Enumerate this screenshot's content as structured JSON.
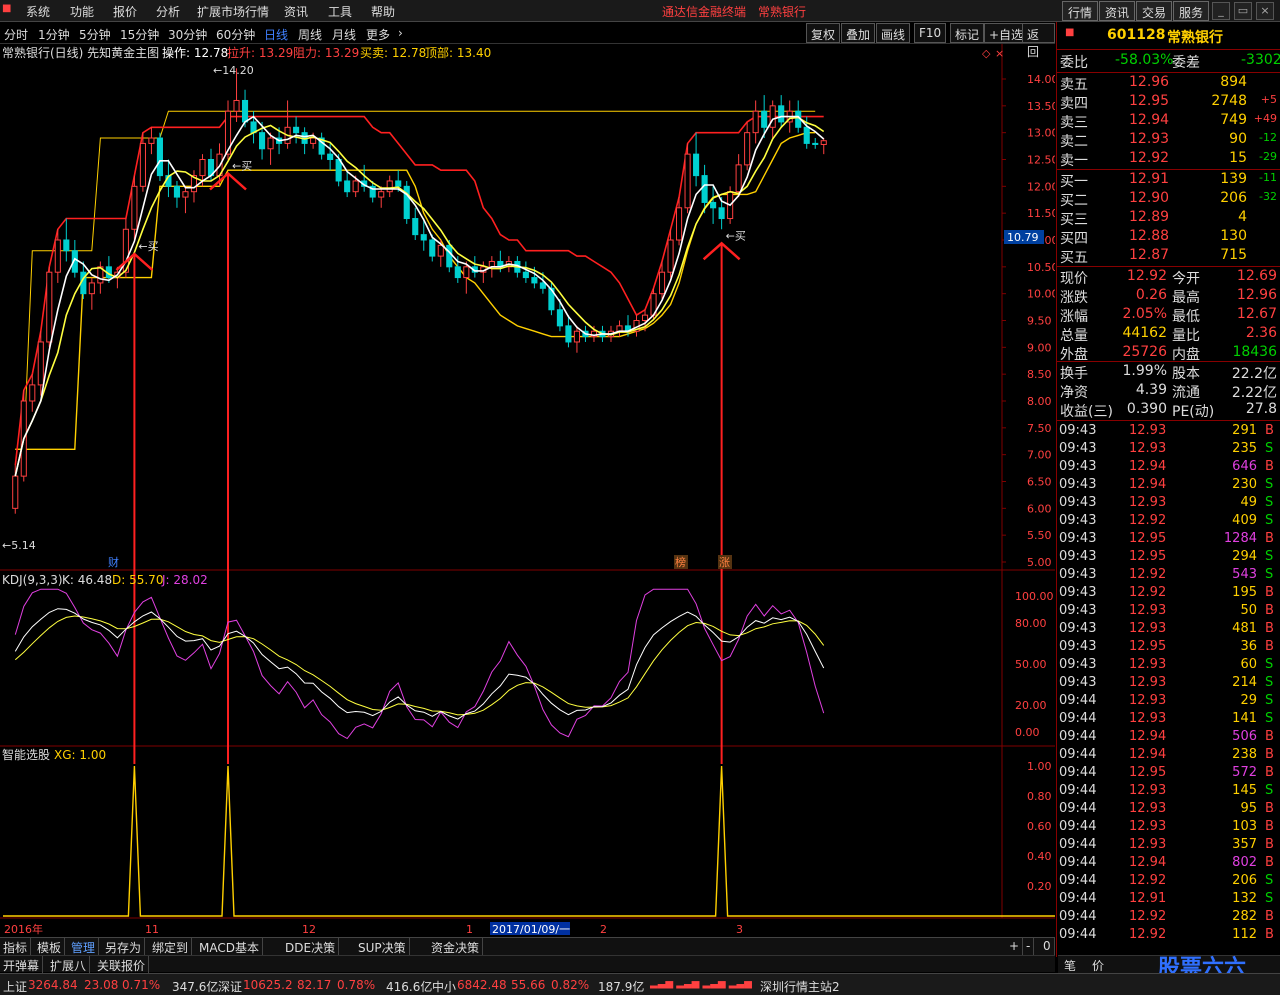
{
  "menu": {
    "items": [
      "系统",
      "功能",
      "报价",
      "分析",
      "扩展市场行情",
      "资讯",
      "工具",
      "帮助"
    ],
    "title": "通达信金融终端",
    "title_stock": "常熟银行",
    "right_buttons": [
      "行情",
      "资讯",
      "交易",
      "服务"
    ]
  },
  "periods": {
    "items": [
      "分时",
      "1分钟",
      "5分钟",
      "15分钟",
      "30分钟",
      "60分钟",
      "日线",
      "周线",
      "月线",
      "更多"
    ],
    "active": "日线",
    "tools": [
      "复权",
      "叠加",
      "画线",
      "F10",
      "标记",
      "+自选",
      "返回"
    ]
  },
  "main_header": {
    "name": "常熟银行(日线) 先知黄金主图",
    "op_label": "操作: 12.78",
    "la_label": "拉升: 13.29",
    "zl_label": "阻力: 13.29",
    "mm_label": "买卖: 12.78",
    "db_label": "顶部: 13.40"
  },
  "chart_data": {
    "type": "candlestick",
    "price_axis": [
      "14.00",
      "13.50",
      "13.00",
      "12.50",
      "12.00",
      "11.50",
      "11.00",
      "10.50",
      "10.00",
      "9.50",
      "9.00",
      "8.50",
      "8.00",
      "7.50",
      "7.00",
      "6.50",
      "6.00",
      "5.50",
      "5.00"
    ],
    "price_range": [
      5.0,
      14.0
    ],
    "current_price_label": "10.79",
    "annotations": {
      "high": "14.20",
      "low": "5.14",
      "buy": "买",
      "cai": "财",
      "bang": "榜",
      "zhang": "涨"
    },
    "candles": [
      [
        6.0,
        6.8,
        5.9,
        6.6
      ],
      [
        6.6,
        8.2,
        6.5,
        8.0
      ],
      [
        8.0,
        8.5,
        7.8,
        8.3
      ],
      [
        8.3,
        9.3,
        8.1,
        9.1
      ],
      [
        9.1,
        10.5,
        9.0,
        10.4
      ],
      [
        10.4,
        11.2,
        10.2,
        11.0
      ],
      [
        11.0,
        11.4,
        10.6,
        10.8
      ],
      [
        10.8,
        11.0,
        10.3,
        10.4
      ],
      [
        10.4,
        10.6,
        9.9,
        10.0
      ],
      [
        10.0,
        10.3,
        9.7,
        10.2
      ],
      [
        10.2,
        10.6,
        10.0,
        10.5
      ],
      [
        10.5,
        10.7,
        10.2,
        10.3
      ],
      [
        10.3,
        10.5,
        10.1,
        10.4
      ],
      [
        10.4,
        11.4,
        10.3,
        11.2
      ],
      [
        11.2,
        12.2,
        11.0,
        12.0
      ],
      [
        12.0,
        13.0,
        11.9,
        12.8
      ],
      [
        12.8,
        13.1,
        12.6,
        12.9
      ],
      [
        12.9,
        13.0,
        12.1,
        12.2
      ],
      [
        12.2,
        12.5,
        11.8,
        12.0
      ],
      [
        12.0,
        12.1,
        11.6,
        11.8
      ],
      [
        11.8,
        12.0,
        11.5,
        11.9
      ],
      [
        11.9,
        12.3,
        11.7,
        12.2
      ],
      [
        12.2,
        12.6,
        12.0,
        12.5
      ],
      [
        12.5,
        12.7,
        12.1,
        12.2
      ],
      [
        12.2,
        12.8,
        12.0,
        12.6
      ],
      [
        12.6,
        13.6,
        12.5,
        13.4
      ],
      [
        13.4,
        14.2,
        13.2,
        13.6
      ],
      [
        13.6,
        13.8,
        13.1,
        13.2
      ],
      [
        13.2,
        13.4,
        12.8,
        13.0
      ],
      [
        13.0,
        13.2,
        12.5,
        12.7
      ],
      [
        12.7,
        13.0,
        12.4,
        12.9
      ],
      [
        12.9,
        13.1,
        12.6,
        12.8
      ],
      [
        12.8,
        13.6,
        12.7,
        13.1
      ],
      [
        13.1,
        13.3,
        12.8,
        13.0
      ],
      [
        13.0,
        13.1,
        12.6,
        12.8
      ],
      [
        12.8,
        13.0,
        12.7,
        12.9
      ],
      [
        12.9,
        13.0,
        12.5,
        12.6
      ],
      [
        12.6,
        12.8,
        12.3,
        12.5
      ],
      [
        12.5,
        12.6,
        12.0,
        12.1
      ],
      [
        12.1,
        12.3,
        11.8,
        11.9
      ],
      [
        11.9,
        12.2,
        11.8,
        12.1
      ],
      [
        12.1,
        12.4,
        11.9,
        12.0
      ],
      [
        12.0,
        12.1,
        11.7,
        11.8
      ],
      [
        11.8,
        12.0,
        11.6,
        11.9
      ],
      [
        11.9,
        12.2,
        11.8,
        12.1
      ],
      [
        12.1,
        12.3,
        11.9,
        12.0
      ],
      [
        12.0,
        12.1,
        11.3,
        11.4
      ],
      [
        11.4,
        11.6,
        11.0,
        11.1
      ],
      [
        11.1,
        11.4,
        10.8,
        11.0
      ],
      [
        11.0,
        11.1,
        10.6,
        10.7
      ],
      [
        10.7,
        11.0,
        10.5,
        10.9
      ],
      [
        10.9,
        11.0,
        10.4,
        10.5
      ],
      [
        10.5,
        10.7,
        10.2,
        10.3
      ],
      [
        10.3,
        10.6,
        10.0,
        10.5
      ],
      [
        10.5,
        10.7,
        10.3,
        10.4
      ],
      [
        10.4,
        10.6,
        10.2,
        10.5
      ],
      [
        10.5,
        10.7,
        10.3,
        10.6
      ],
      [
        10.6,
        10.8,
        10.4,
        10.5
      ],
      [
        10.5,
        10.7,
        10.4,
        10.6
      ],
      [
        10.6,
        10.7,
        10.3,
        10.4
      ],
      [
        10.4,
        10.6,
        10.2,
        10.3
      ],
      [
        10.3,
        10.5,
        10.1,
        10.2
      ],
      [
        10.2,
        10.4,
        10.0,
        10.1
      ],
      [
        10.1,
        10.2,
        9.6,
        9.7
      ],
      [
        9.7,
        9.9,
        9.3,
        9.4
      ],
      [
        9.4,
        9.6,
        9.0,
        9.1
      ],
      [
        9.1,
        9.4,
        8.9,
        9.3
      ],
      [
        9.3,
        9.4,
        9.1,
        9.2
      ],
      [
        9.2,
        9.4,
        9.1,
        9.3
      ],
      [
        9.3,
        9.4,
        9.1,
        9.2
      ],
      [
        9.2,
        9.4,
        9.1,
        9.3
      ],
      [
        9.3,
        9.5,
        9.2,
        9.4
      ],
      [
        9.4,
        9.6,
        9.2,
        9.3
      ],
      [
        9.3,
        9.6,
        9.2,
        9.5
      ],
      [
        9.5,
        9.7,
        9.3,
        9.6
      ],
      [
        9.6,
        10.1,
        9.5,
        10.0
      ],
      [
        10.0,
        10.6,
        9.9,
        10.4
      ],
      [
        10.4,
        11.2,
        10.3,
        11.0
      ],
      [
        11.0,
        11.8,
        10.9,
        11.6
      ],
      [
        11.6,
        12.8,
        11.5,
        12.6
      ],
      [
        12.6,
        13.0,
        12.0,
        12.2
      ],
      [
        12.2,
        12.4,
        11.5,
        11.7
      ],
      [
        11.7,
        12.0,
        11.3,
        11.6
      ],
      [
        11.6,
        11.8,
        11.2,
        11.4
      ],
      [
        11.4,
        12.0,
        11.3,
        11.9
      ],
      [
        11.9,
        12.6,
        11.8,
        12.4
      ],
      [
        12.4,
        13.2,
        12.3,
        13.0
      ],
      [
        13.0,
        13.6,
        12.8,
        13.4
      ],
      [
        13.4,
        13.7,
        12.9,
        13.1
      ],
      [
        13.1,
        13.6,
        12.9,
        13.5
      ],
      [
        13.5,
        13.7,
        13.1,
        13.2
      ],
      [
        13.2,
        13.6,
        13.0,
        13.4
      ],
      [
        13.4,
        13.6,
        13.0,
        13.1
      ],
      [
        13.1,
        13.3,
        12.7,
        12.8
      ],
      [
        12.8,
        12.9,
        12.7,
        12.78
      ],
      [
        12.78,
        12.9,
        12.6,
        12.85
      ]
    ],
    "yellow_band": [
      7.1,
      7.1,
      7.1,
      7.1,
      7.1,
      7.1,
      7.1,
      7.1,
      10.3,
      10.3,
      10.3,
      10.3,
      10.3,
      10.3,
      10.3,
      10.3,
      10.3,
      12.0,
      12.0,
      12.0,
      12.0,
      12.0,
      12.0,
      12.0,
      12.0,
      12.3,
      12.3,
      12.3,
      12.3,
      12.3,
      12.3,
      12.3,
      12.3,
      12.3,
      12.3,
      12.3,
      12.3,
      12.3,
      12.3,
      12.3,
      12.3,
      12.3,
      12.3,
      12.3,
      12.3,
      12.3,
      12.3,
      12.0,
      11.5,
      11.2,
      11.0,
      10.7,
      10.5,
      10.3,
      10.2,
      10.0,
      9.8,
      9.6,
      9.5,
      9.4,
      9.35,
      9.3,
      9.25,
      9.2,
      9.2,
      9.2,
      9.2,
      9.2,
      9.2,
      9.2,
      9.2,
      9.2,
      9.25,
      9.3,
      9.35,
      9.45,
      9.6,
      9.8,
      10.2,
      10.8,
      11.3,
      11.6,
      11.8,
      11.85,
      11.85,
      11.85,
      11.85,
      11.9,
      12.2,
      12.5,
      12.8,
      12.9,
      12.95,
      13.0,
      13.0
    ],
    "top_band": [
      7.1,
      7.1,
      10.8,
      10.8,
      10.8,
      10.8,
      10.8,
      10.8,
      10.8,
      10.8,
      12.9,
      12.9,
      12.9,
      12.9,
      12.9,
      12.9,
      12.9,
      12.9,
      13.4,
      13.4,
      13.4,
      13.4,
      13.4,
      13.4,
      13.4,
      13.4,
      13.4,
      13.4,
      13.4,
      13.4,
      13.4,
      13.4,
      13.4,
      13.4,
      13.4,
      13.4,
      13.4,
      13.4,
      13.4,
      13.4,
      13.4,
      13.4,
      13.4,
      13.4,
      13.4,
      13.4,
      13.4,
      13.4,
      13.4,
      13.4,
      13.4,
      13.4,
      13.4,
      13.4,
      13.4,
      13.4,
      13.4,
      13.4,
      13.4,
      13.4,
      13.4,
      13.4,
      13.4,
      13.4,
      13.4,
      13.4,
      13.4,
      13.4,
      13.4,
      13.4,
      13.4,
      13.4,
      13.4,
      13.4,
      13.4,
      13.4,
      13.4,
      13.4,
      13.4,
      13.4,
      13.4,
      13.4,
      13.4,
      13.4,
      13.4,
      13.4,
      13.4,
      13.4,
      13.4,
      13.4,
      13.4,
      13.4,
      13.4,
      13.4,
      13.4
    ],
    "kdj_label": "KDJ(9,3,3)",
    "kdj_k_label": "K: 46.48",
    "kdj_d_label": "D: 55.70",
    "kdj_j_label": "J: 28.02",
    "kdj_axis": [
      "100.00",
      "80.00",
      "50.00",
      "20.00",
      "0.00"
    ],
    "xg_label": "智能选股",
    "xg_value_label": "XG: 1.00",
    "xg_axis": [
      "1.00",
      "0.80",
      "0.60",
      "0.40",
      "0.20"
    ],
    "xg_signal_idx": [
      14,
      25,
      83,
      143
    ],
    "time_labels": [
      "2016年",
      "11",
      "12",
      "1",
      "2017/01/09/一",
      "2",
      "3"
    ]
  },
  "quote": {
    "code": "601128",
    "name": "常熟银行",
    "weibi_label": "委比",
    "weibi": "-58.03%",
    "weicha_label": "委差",
    "weicha": "-3302",
    "sells": [
      {
        "label": "卖五",
        "price": "12.96",
        "vol": "894",
        "chg": ""
      },
      {
        "label": "卖四",
        "price": "12.95",
        "vol": "2748",
        "chg": "+5"
      },
      {
        "label": "卖三",
        "price": "12.94",
        "vol": "749",
        "chg": "+49"
      },
      {
        "label": "卖二",
        "price": "12.93",
        "vol": "90",
        "chg": "-12"
      },
      {
        "label": "卖一",
        "price": "12.92",
        "vol": "15",
        "chg": "-29"
      }
    ],
    "buys": [
      {
        "label": "买一",
        "price": "12.91",
        "vol": "139",
        "chg": "-11"
      },
      {
        "label": "买二",
        "price": "12.90",
        "vol": "206",
        "chg": "-32"
      },
      {
        "label": "买三",
        "price": "12.89",
        "vol": "4",
        "chg": ""
      },
      {
        "label": "买四",
        "price": "12.88",
        "vol": "130",
        "chg": ""
      },
      {
        "label": "买五",
        "price": "12.87",
        "vol": "715",
        "chg": ""
      }
    ],
    "stats": [
      {
        "l1": "现价",
        "v1": "12.92",
        "l2": "今开",
        "v2": "12.69"
      },
      {
        "l1": "涨跌",
        "v1": "0.26",
        "l2": "最高",
        "v2": "12.96"
      },
      {
        "l1": "涨幅",
        "v1": "2.05%",
        "l2": "最低",
        "v2": "12.67"
      },
      {
        "l1": "总量",
        "v1": "44162",
        "l2": "量比",
        "v2": "2.36"
      },
      {
        "l1": "外盘",
        "v1": "25726",
        "l2": "内盘",
        "v2": "18436"
      }
    ],
    "fund": [
      {
        "l1": "换手",
        "v1": "1.99%",
        "l2": "股本",
        "v2": "22.2亿"
      },
      {
        "l1": "净资",
        "v1": "4.39",
        "l2": "流通",
        "v2": "2.22亿"
      },
      {
        "l1": "收益(三)",
        "v1": "0.390",
        "l2": "PE(动)",
        "v2": "27.8"
      }
    ]
  },
  "ticks": [
    [
      "09:43",
      "12.93",
      "291",
      "B"
    ],
    [
      "09:43",
      "12.93",
      "235",
      "S"
    ],
    [
      "09:43",
      "12.94",
      "646",
      "B"
    ],
    [
      "09:43",
      "12.94",
      "230",
      "S"
    ],
    [
      "09:43",
      "12.93",
      "49",
      "S"
    ],
    [
      "09:43",
      "12.92",
      "409",
      "S"
    ],
    [
      "09:43",
      "12.95",
      "1284",
      "B"
    ],
    [
      "09:43",
      "12.95",
      "294",
      "S"
    ],
    [
      "09:43",
      "12.92",
      "543",
      "S"
    ],
    [
      "09:43",
      "12.92",
      "195",
      "B"
    ],
    [
      "09:43",
      "12.93",
      "50",
      "B"
    ],
    [
      "09:43",
      "12.93",
      "481",
      "B"
    ],
    [
      "09:43",
      "12.95",
      "36",
      "B"
    ],
    [
      "09:43",
      "12.93",
      "60",
      "S"
    ],
    [
      "09:43",
      "12.93",
      "214",
      "S"
    ],
    [
      "09:44",
      "12.93",
      "29",
      "S"
    ],
    [
      "09:44",
      "12.93",
      "141",
      "S"
    ],
    [
      "09:44",
      "12.94",
      "506",
      "B"
    ],
    [
      "09:44",
      "12.94",
      "238",
      "B"
    ],
    [
      "09:44",
      "12.95",
      "572",
      "B"
    ],
    [
      "09:44",
      "12.93",
      "145",
      "S"
    ],
    [
      "09:44",
      "12.93",
      "95",
      "B"
    ],
    [
      "09:44",
      "12.93",
      "103",
      "B"
    ],
    [
      "09:44",
      "12.93",
      "357",
      "B"
    ],
    [
      "09:44",
      "12.94",
      "802",
      "B"
    ],
    [
      "09:44",
      "12.92",
      "206",
      "S"
    ],
    [
      "09:44",
      "12.91",
      "132",
      "S"
    ],
    [
      "09:44",
      "12.92",
      "282",
      "B"
    ],
    [
      "09:44",
      "12.92",
      "112",
      "B"
    ]
  ],
  "bottom_tabs": [
    "指标",
    "模板",
    "管理",
    "另存为",
    "绑定到",
    "MACD基本",
    "DDE决策",
    "SUP决策",
    "资金决策"
  ],
  "bottom_tabs2": [
    "开弹幕",
    "扩展八",
    "关联报价"
  ],
  "bottom_right": [
    "+",
    "-",
    "0"
  ],
  "status": {
    "sh_label": "上证",
    "sh": "3264.84",
    "sh_chg": "23.08",
    "sh_pct": "0.71%",
    "sh_amt": "347.6亿",
    "sz_label": "深证",
    "sz": "10625.2",
    "sz_chg": "82.17",
    "sz_pct": "0.78%",
    "sz_amt": "416.6亿",
    "zx_label": "中小",
    "zx": "6842.48",
    "zx_chg": "55.66",
    "zx_pct": "0.82%",
    "zx_amt": "187.9亿",
    "server": "深圳行情主站2",
    "brand": "股票六六",
    "rp_bottom": [
      "笔",
      "价"
    ]
  },
  "colors": {
    "up": "#ff4040",
    "down": "#00d0d0",
    "accent": "#ffd000",
    "grid": "#800000"
  }
}
